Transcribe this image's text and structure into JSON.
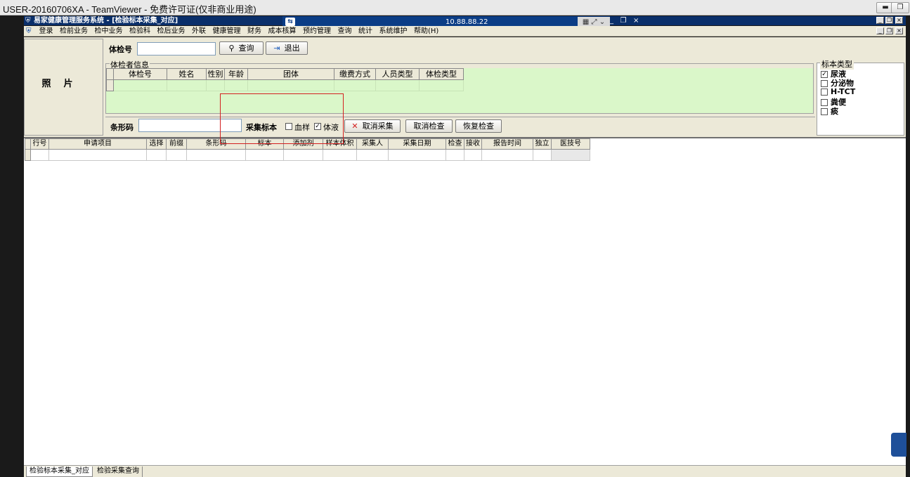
{
  "teamviewer": {
    "title": "USER-20160706XA - TeamViewer - 免费许可证(仅非商业用途)",
    "ip": "10.88.88.22",
    "min_icon": "minimize-icon",
    "restore_icon": "restore-icon",
    "close_icon": "close-icon"
  },
  "app": {
    "title": "易家健康管理服务系统 - [检验标本采集_对应]",
    "menu": [
      "登录",
      "检前业务",
      "检中业务",
      "检验科",
      "检后业务",
      "外联",
      "健康管理",
      "财务",
      "成本核算",
      "预约管理",
      "查询",
      "统计",
      "系统维护",
      "帮助(H)"
    ]
  },
  "photo": {
    "label": "照片"
  },
  "search": {
    "label": "体检号",
    "value": "",
    "query_btn": "查询",
    "exit_btn": "退出"
  },
  "info": {
    "legend": "体检者信息",
    "columns": [
      "体检号",
      "姓名",
      "性别",
      "年龄",
      "团体",
      "缴费方式",
      "人员类型",
      "体检类型"
    ]
  },
  "barcode": {
    "label": "条形码",
    "value": "",
    "collect_label": "采集标本",
    "blood_label": "血样",
    "blood_checked": false,
    "urine_label": "体液",
    "urine_checked": true,
    "cancel_collect": "取消采集",
    "cancel_check": "取消检查",
    "restore_check": "恢复检查"
  },
  "specimen": {
    "legend": "标本类型",
    "items": [
      {
        "label": "尿液",
        "checked": true
      },
      {
        "label": "分泌物",
        "checked": false
      },
      {
        "label": "H-TCT",
        "checked": false
      },
      {
        "label": "粪便",
        "checked": false
      },
      {
        "label": "痰",
        "checked": false
      }
    ]
  },
  "lower_table": {
    "columns": [
      "行号",
      "申请项目",
      "选择",
      "前缀",
      "条形码",
      "标本",
      "添加剂",
      "样本体积",
      "采集人",
      "采集日期",
      "检查",
      "接收",
      "报告时间",
      "独立",
      "医技号"
    ]
  },
  "tabs": [
    "检验标本采集_对应",
    "检验采集查询"
  ]
}
